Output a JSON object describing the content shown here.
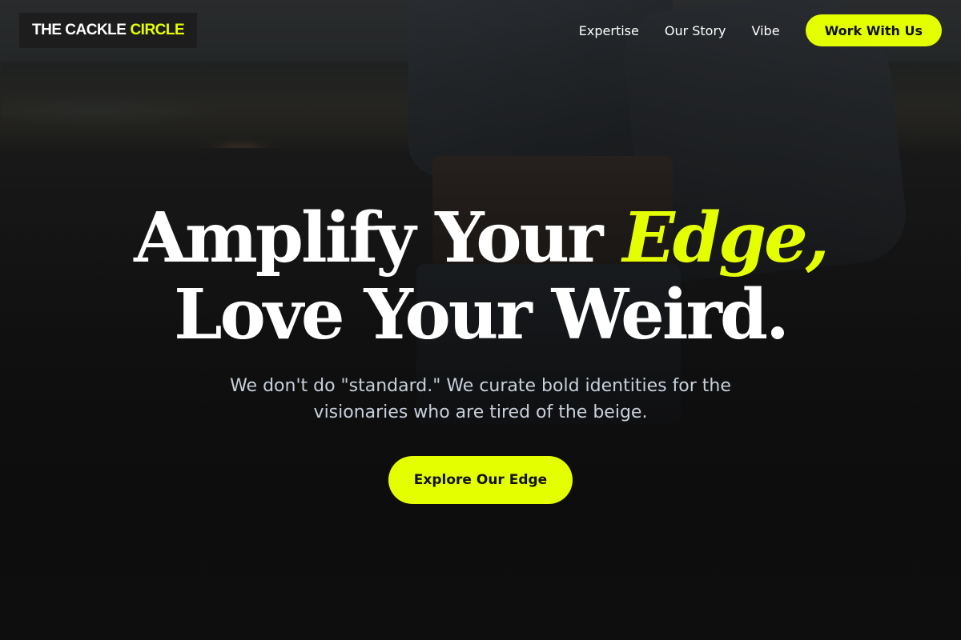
{
  "brand": {
    "name_main": "THE CACKLE",
    "name_accent": "CIRCLE",
    "accent_color": "#e4ff00"
  },
  "nav": {
    "links": [
      "Expertise",
      "Our Story",
      "Vibe"
    ],
    "cta_label": "Work With Us"
  },
  "hero": {
    "headline_part1": "Amplify Your ",
    "headline_accent": "Edge,",
    "headline_line2": "Love Your Weird.",
    "subtitle": "We don't do \"standard.\" We curate bold identities for the visionaries who are tired of the beige.",
    "cta_label": "Explore Our Edge"
  }
}
